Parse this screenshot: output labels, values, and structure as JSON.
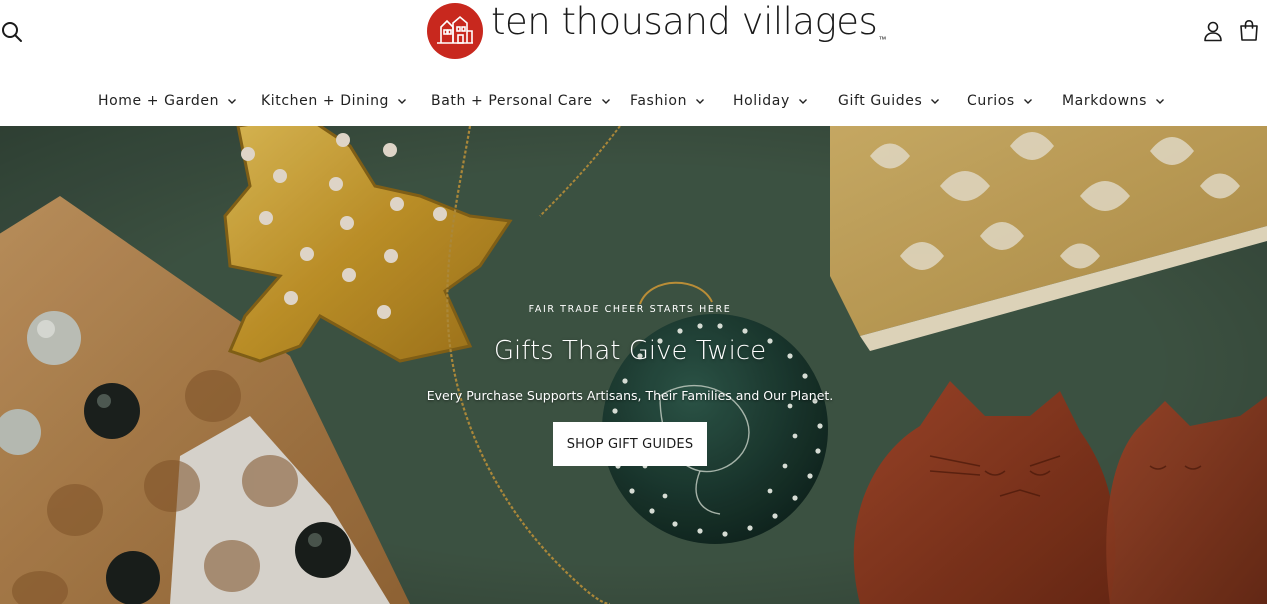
{
  "brand": {
    "name": "ten thousand villages",
    "trademark": "™",
    "logo_color": "#c8281e"
  },
  "header": {
    "search_icon": "search-icon",
    "account_icon": "user-icon",
    "cart_icon": "shopping-bag-icon"
  },
  "nav": {
    "items": [
      {
        "label": "Home + Garden"
      },
      {
        "label": "Kitchen + Dining"
      },
      {
        "label": "Bath + Personal Care"
      },
      {
        "label": "Fashion"
      },
      {
        "label": "Holiday"
      },
      {
        "label": "Gift Guides"
      },
      {
        "label": "Curios"
      },
      {
        "label": "Markdowns"
      }
    ]
  },
  "hero": {
    "eyebrow": "FAIR TRADE CHEER STARTS HERE",
    "title": "Gifts That Give Twice",
    "subtitle": "Every Purchase Supports Artisans, Their Families and Our Planet.",
    "cta_label": "SHOP GIFT GUIDES",
    "background_color": "#3f5646"
  }
}
